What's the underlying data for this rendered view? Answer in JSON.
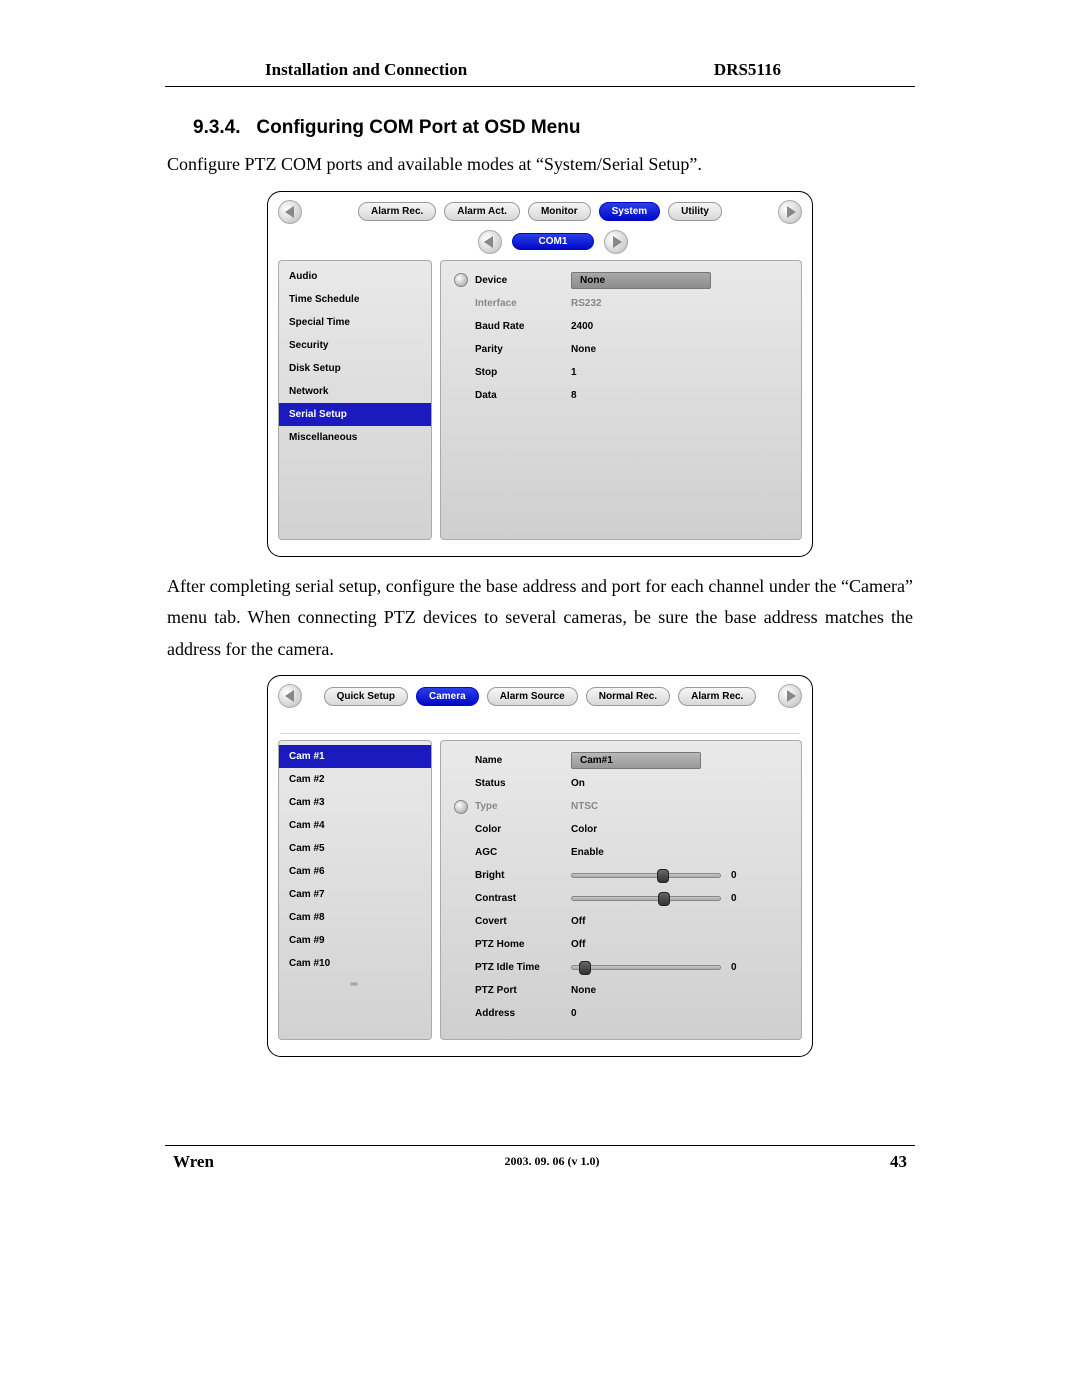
{
  "header": {
    "left": "Installation and Connection",
    "right": "DRS5116"
  },
  "section": {
    "number": "9.3.4.",
    "title": "Configuring COM Port at OSD Menu"
  },
  "intro_text": "Configure PTZ COM ports and available modes at “System/Serial Setup”.",
  "osd1": {
    "tabs": [
      "Alarm Rec.",
      "Alarm Act.",
      "Monitor",
      "System",
      "Utility"
    ],
    "active_tab_index": 3,
    "sub_tab": "COM1",
    "sidebar": {
      "items": [
        "Audio",
        "Time Schedule",
        "Special Time",
        "Security",
        "Disk Setup",
        "Network",
        "Serial Setup",
        "Miscellaneous"
      ],
      "active_index": 6
    },
    "details": [
      {
        "label": "Device",
        "value": "None",
        "bullet": true,
        "highlight": true
      },
      {
        "label": "Interface",
        "value": "RS232",
        "dim": true
      },
      {
        "label": "Baud Rate",
        "value": "2400"
      },
      {
        "label": "Parity",
        "value": "None"
      },
      {
        "label": "Stop",
        "value": "1"
      },
      {
        "label": "Data",
        "value": "8"
      }
    ]
  },
  "mid_text": "After completing serial setup, configure the base address and port for each channel under the “Camera” menu tab.   When connecting PTZ devices to several cameras, be sure the base address matches the address for the camera.",
  "osd2": {
    "tabs": [
      "Quick Setup",
      "Camera",
      "Alarm Source",
      "Normal Rec.",
      "Alarm Rec."
    ],
    "active_tab_index": 1,
    "sidebar": {
      "items": [
        "Cam #1",
        "Cam #2",
        "Cam #3",
        "Cam #4",
        "Cam #5",
        "Cam #6",
        "Cam #7",
        "Cam #8",
        "Cam #9",
        "Cam #10"
      ],
      "active_index": 0
    },
    "details": [
      {
        "label": "Name",
        "value": "Cam#1",
        "input": true
      },
      {
        "label": "Status",
        "value": "On"
      },
      {
        "label": "Type",
        "value": "NTSC",
        "dim": true,
        "bullet": true
      },
      {
        "label": "Color",
        "value": "Color"
      },
      {
        "label": "AGC",
        "value": "Enable"
      },
      {
        "label": "Bright",
        "slider": 0.62,
        "num": "0"
      },
      {
        "label": "Contrast",
        "slider": 0.63,
        "num": "0"
      },
      {
        "label": "Covert",
        "value": "Off"
      },
      {
        "label": "PTZ Home",
        "value": "Off"
      },
      {
        "label": "PTZ Idle Time",
        "slider": 0.06,
        "num": "0"
      },
      {
        "label": "PTZ Port",
        "value": "None"
      },
      {
        "label": "Address",
        "value": "0"
      }
    ]
  },
  "footer": {
    "wren": "Wren",
    "version": "2003. 09. 06 (v 1.0)",
    "page": "43"
  }
}
